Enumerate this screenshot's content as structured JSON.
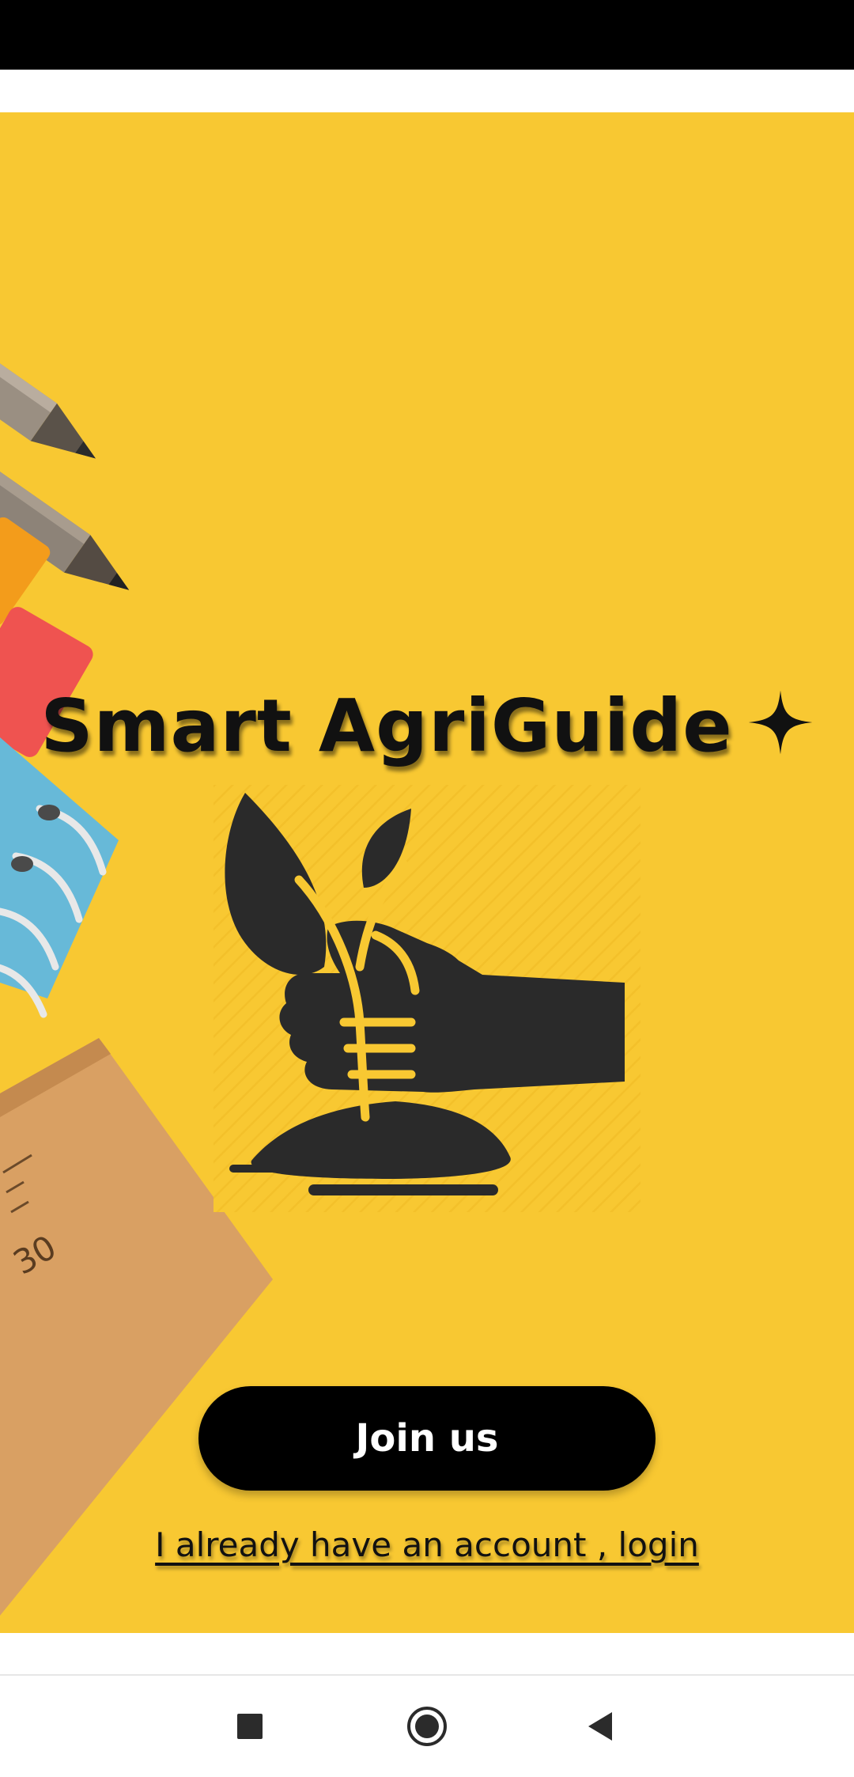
{
  "app": {
    "title": "Smart AgriGuide",
    "title_icon": "sparkle-icon",
    "logo_icon": "hand-holding-plant-icon",
    "background_color": "#f8c832"
  },
  "actions": {
    "join_label": "Join us",
    "login_label": "I already have an account , login"
  },
  "system_nav": {
    "recents_icon": "square-recents-icon",
    "home_icon": "circle-home-icon",
    "back_icon": "triangle-back-icon"
  },
  "artwork": {
    "ruler_mark": "30"
  }
}
